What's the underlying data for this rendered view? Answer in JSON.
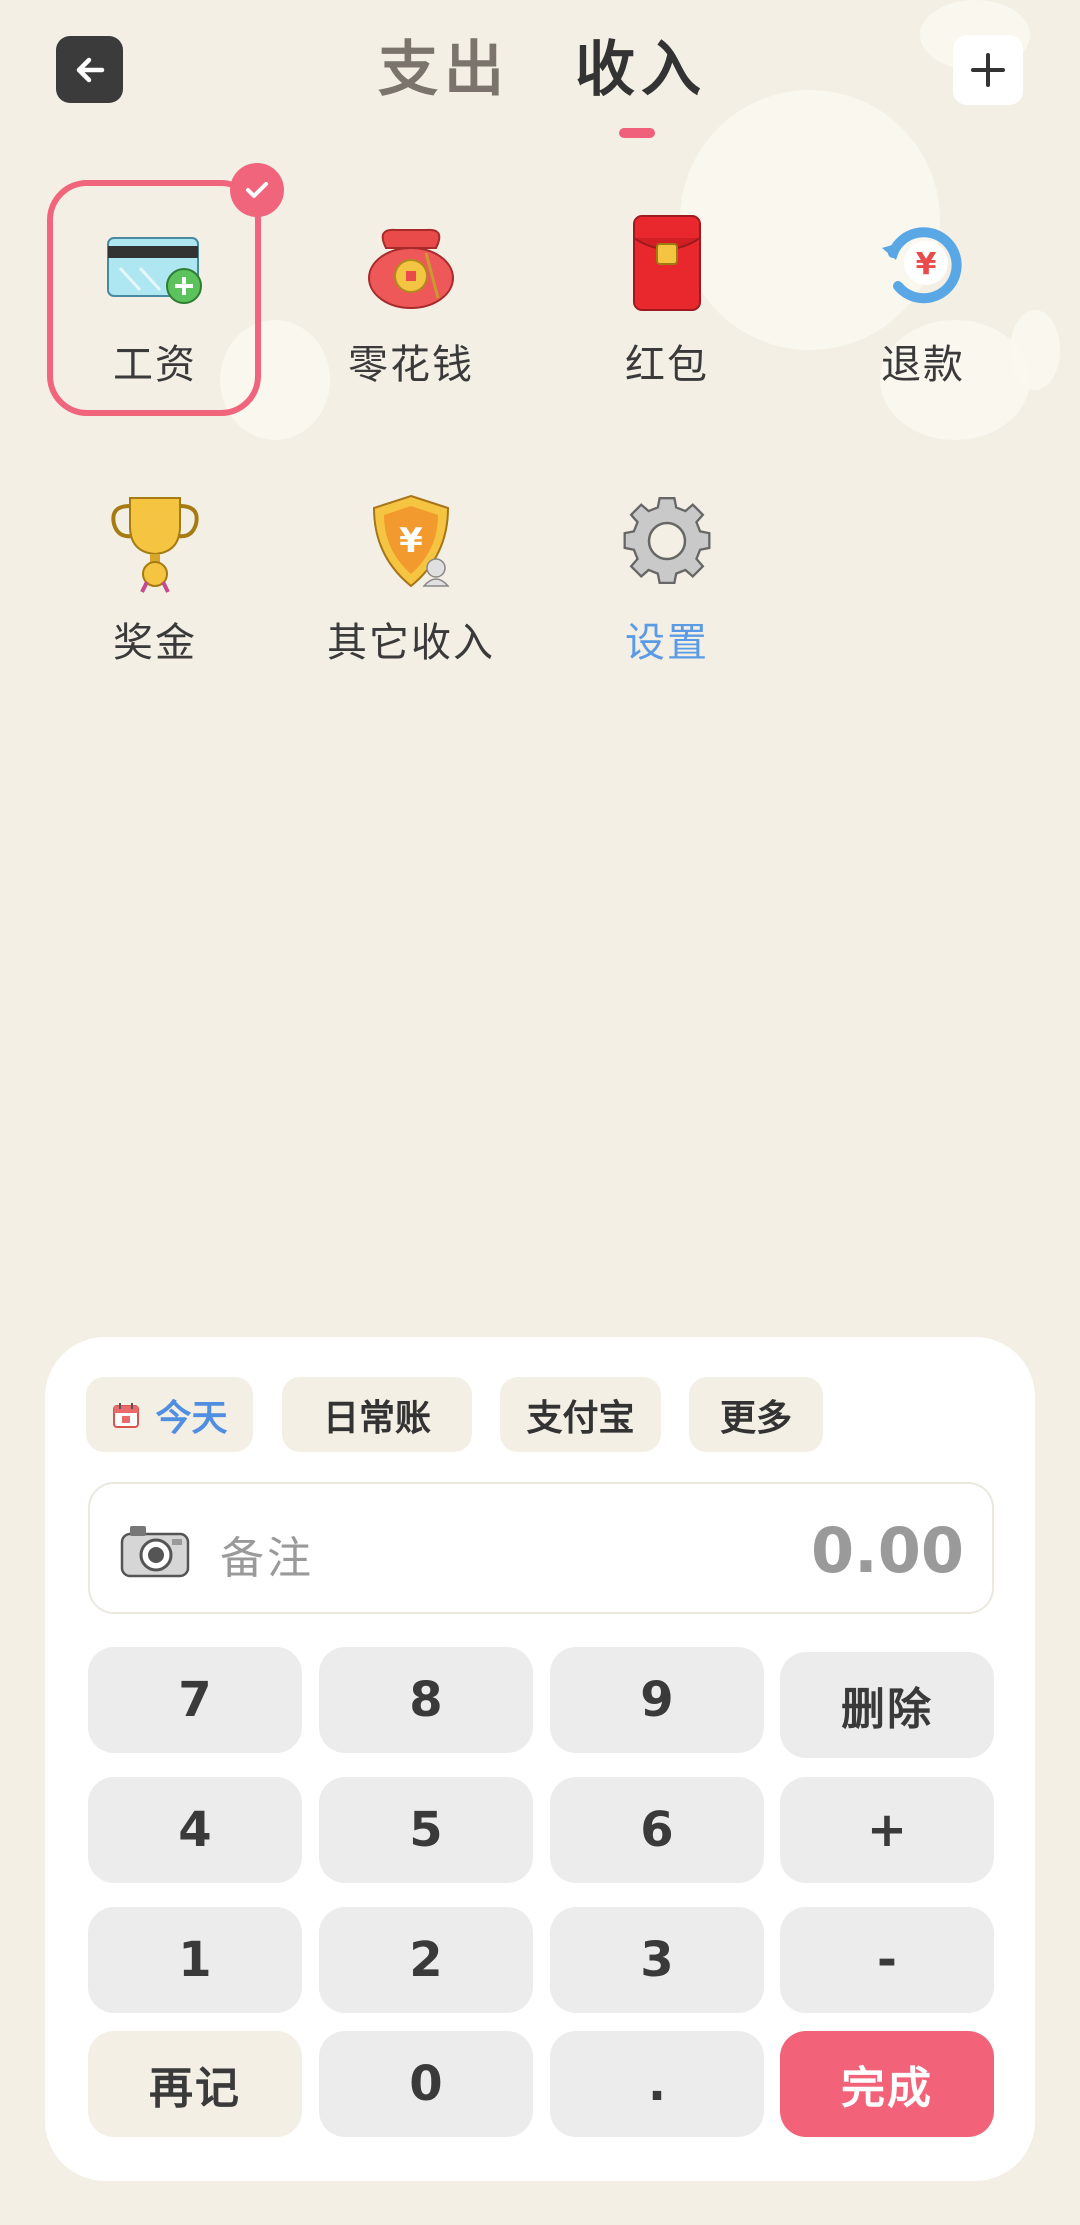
{
  "header": {
    "tabs": [
      {
        "label": "支出",
        "active": false
      },
      {
        "label": "收入",
        "active": true
      }
    ]
  },
  "categories": [
    {
      "label": "工资",
      "icon": "wage-card-icon",
      "selected": true
    },
    {
      "label": "零花钱",
      "icon": "money-bag-icon",
      "selected": false
    },
    {
      "label": "红包",
      "icon": "red-envelope-icon",
      "selected": false
    },
    {
      "label": "退款",
      "icon": "refund-icon",
      "selected": false
    },
    {
      "label": "奖金",
      "icon": "trophy-icon",
      "selected": false
    },
    {
      "label": "其它收入",
      "icon": "other-income-icon",
      "selected": false
    },
    {
      "label": "设置",
      "icon": "gear-icon",
      "selected": false
    }
  ],
  "panel": {
    "chips": {
      "today": "今天",
      "daily": "日常账",
      "alipay": "支付宝",
      "more": "更多"
    },
    "note_placeholder": "备注",
    "amount": "0.00",
    "keypad": {
      "k7": "7",
      "k8": "8",
      "k9": "9",
      "delete": "删除",
      "k4": "4",
      "k5": "5",
      "k6": "6",
      "plus": "+",
      "k1": "1",
      "k2": "2",
      "k3": "3",
      "minus": "-",
      "again": "再记",
      "k0": "0",
      "dot": ".",
      "done": "完成"
    }
  },
  "colors": {
    "background": "#f3efe4",
    "accent": "#f0647c",
    "link_blue": "#5b9be6"
  }
}
